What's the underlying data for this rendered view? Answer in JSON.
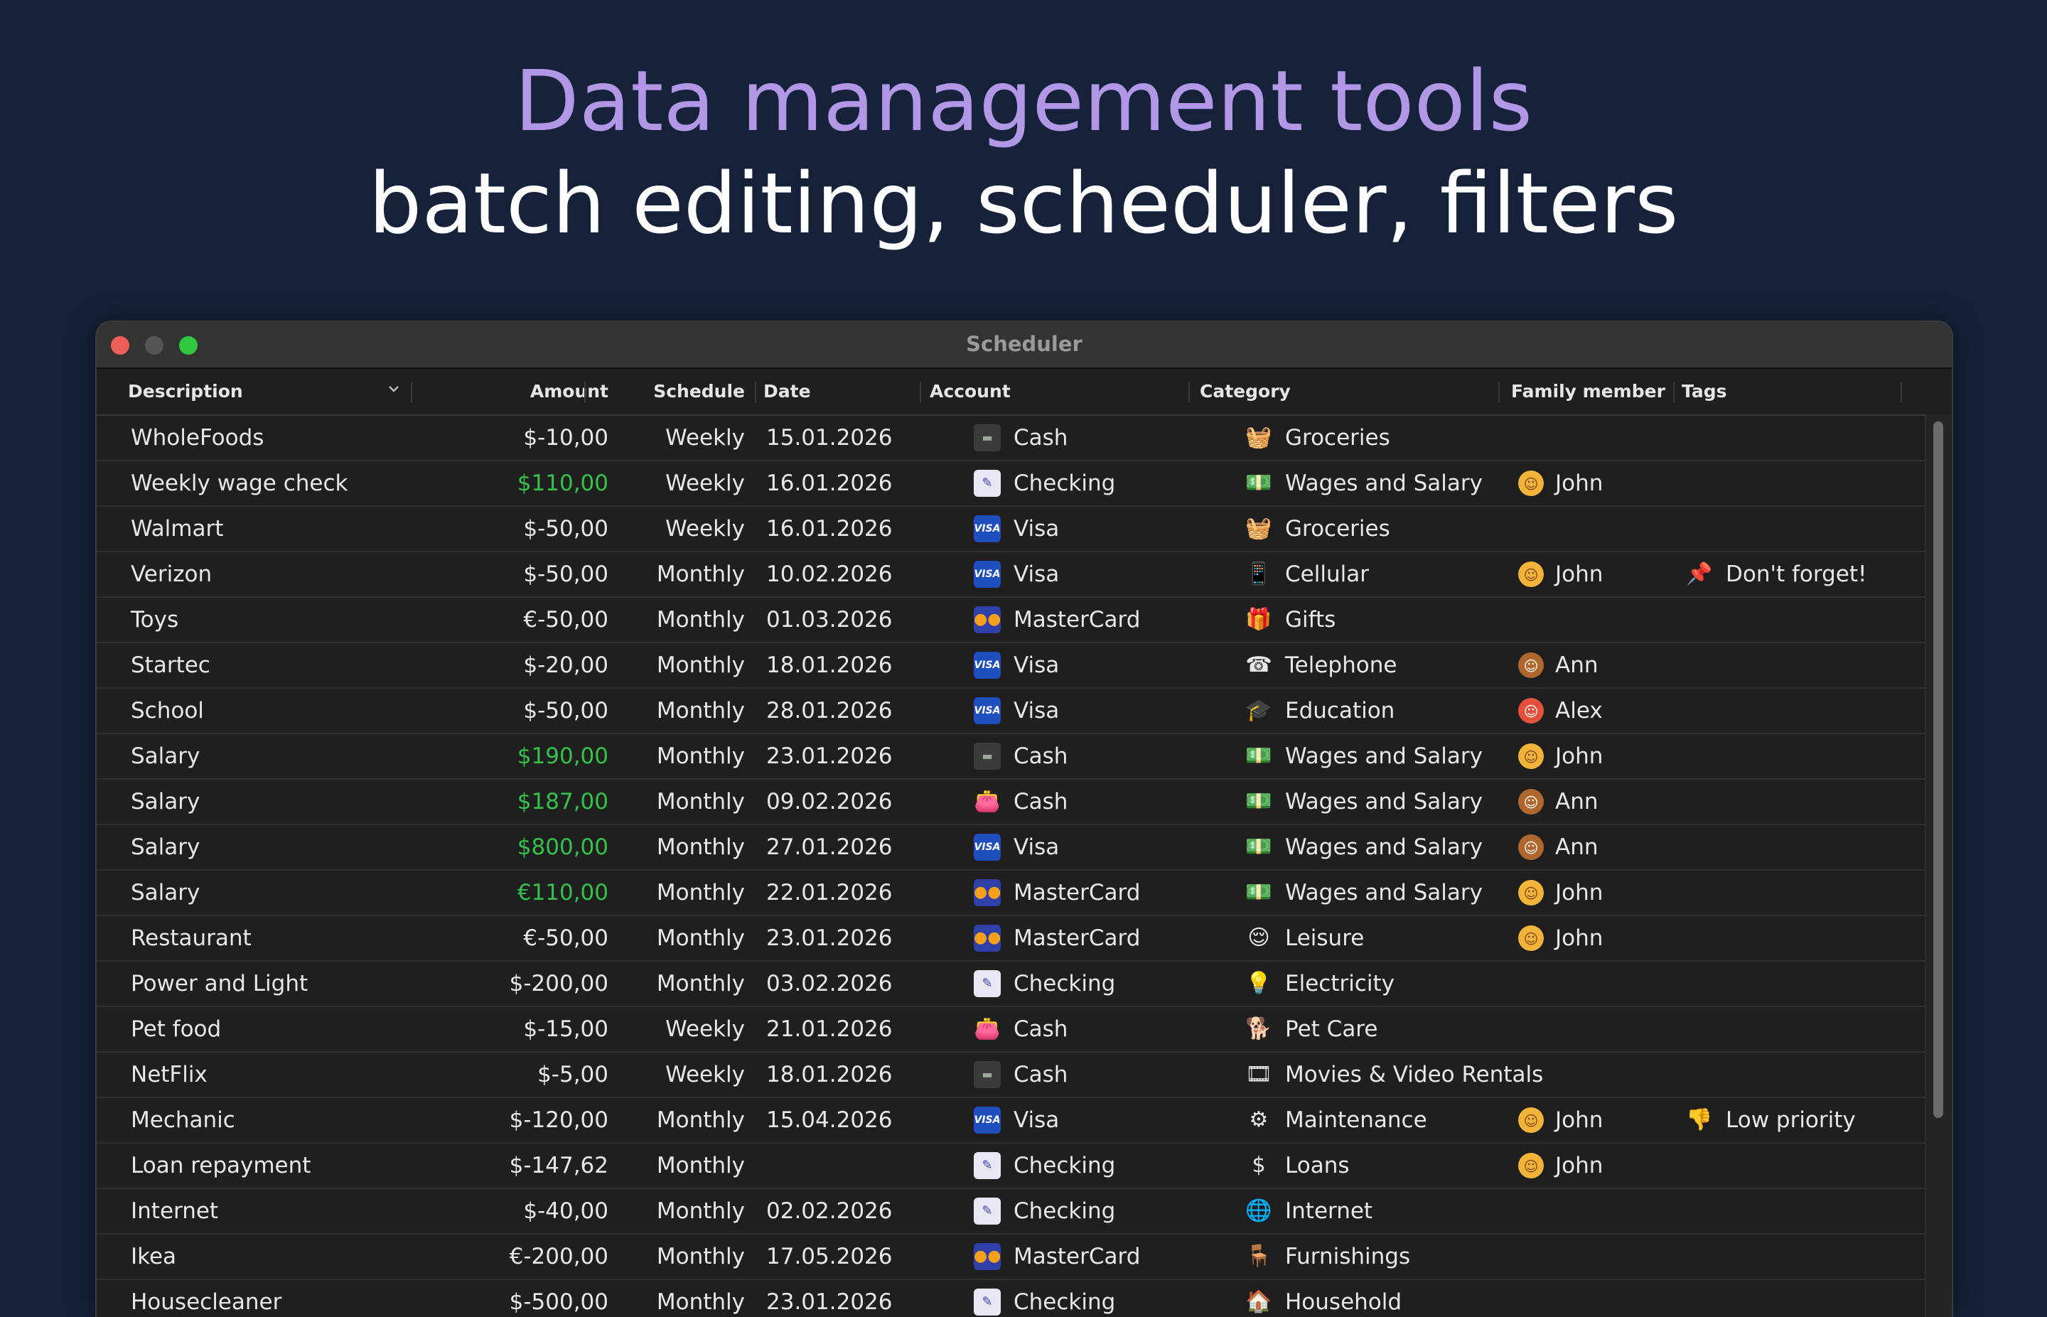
{
  "headline": {
    "line1": "Data management tools",
    "line2": "batch editing, scheduler, filters"
  },
  "window": {
    "title": "Scheduler"
  },
  "columns": {
    "description": "Description",
    "amount": "Amount",
    "schedule": "Schedule",
    "date": "Date",
    "account": "Account",
    "category": "Category",
    "family": "Family member",
    "tags": "Tags"
  },
  "rows": [
    {
      "desc": "WholeFoods",
      "amount": "$-10,00",
      "positive": false,
      "schedule": "Weekly",
      "date": "15.01.2026",
      "account": "Cash",
      "account_icon": "wallet-icon",
      "category": "Groceries",
      "category_icon": "grocery-basket-icon",
      "family": "",
      "tag": ""
    },
    {
      "desc": "Weekly wage check",
      "amount": "$110,00",
      "positive": true,
      "schedule": "Weekly",
      "date": "16.01.2026",
      "account": "Checking",
      "account_icon": "check-icon",
      "category": "Wages and Salary",
      "category_icon": "money-envelope-icon",
      "family": "John",
      "tag": ""
    },
    {
      "desc": "Walmart",
      "amount": "$-50,00",
      "positive": false,
      "schedule": "Weekly",
      "date": "16.01.2026",
      "account": "Visa",
      "account_icon": "visa-card-icon",
      "category": "Groceries",
      "category_icon": "grocery-basket-icon",
      "family": "",
      "tag": ""
    },
    {
      "desc": "Verizon",
      "amount": "$-50,00",
      "positive": false,
      "schedule": "Monthly",
      "date": "10.02.2026",
      "account": "Visa",
      "account_icon": "visa-card-icon",
      "category": "Cellular",
      "category_icon": "phone-icon",
      "family": "John",
      "tag": "Don't forget!"
    },
    {
      "desc": "Toys",
      "amount": "€-50,00",
      "positive": false,
      "schedule": "Monthly",
      "date": "01.03.2026",
      "account": "MasterCard",
      "account_icon": "mastercard-icon",
      "category": "Gifts",
      "category_icon": "gift-icon",
      "family": "",
      "tag": ""
    },
    {
      "desc": "Startec",
      "amount": "$-20,00",
      "positive": false,
      "schedule": "Monthly",
      "date": "18.01.2026",
      "account": "Visa",
      "account_icon": "visa-card-icon",
      "category": "Telephone",
      "category_icon": "telephone-icon",
      "family": "Ann",
      "tag": ""
    },
    {
      "desc": "School",
      "amount": "$-50,00",
      "positive": false,
      "schedule": "Monthly",
      "date": "28.01.2026",
      "account": "Visa",
      "account_icon": "visa-card-icon",
      "category": "Education",
      "category_icon": "graduation-cap-icon",
      "family": "Alex",
      "tag": ""
    },
    {
      "desc": "Salary",
      "amount": "$190,00",
      "positive": true,
      "schedule": "Monthly",
      "date": "23.01.2026",
      "account": "Cash",
      "account_icon": "wallet-icon",
      "category": "Wages and Salary",
      "category_icon": "money-envelope-icon",
      "family": "John",
      "tag": ""
    },
    {
      "desc": "Salary",
      "amount": "$187,00",
      "positive": true,
      "schedule": "Monthly",
      "date": "09.02.2026",
      "account": "Cash",
      "account_icon": "purse-icon",
      "category": "Wages and Salary",
      "category_icon": "money-envelope-icon",
      "family": "Ann",
      "tag": ""
    },
    {
      "desc": "Salary",
      "amount": "$800,00",
      "positive": true,
      "schedule": "Monthly",
      "date": "27.01.2026",
      "account": "Visa",
      "account_icon": "visa-card-icon",
      "category": "Wages and Salary",
      "category_icon": "money-envelope-icon",
      "family": "Ann",
      "tag": ""
    },
    {
      "desc": "Salary",
      "amount": "€110,00",
      "positive": true,
      "schedule": "Monthly",
      "date": "22.01.2026",
      "account": "MasterCard",
      "account_icon": "mastercard-icon",
      "category": "Wages and Salary",
      "category_icon": "money-envelope-icon",
      "family": "John",
      "tag": ""
    },
    {
      "desc": "Restaurant",
      "amount": "€-50,00",
      "positive": false,
      "schedule": "Monthly",
      "date": "23.01.2026",
      "account": "MasterCard",
      "account_icon": "mastercard-icon",
      "category": "Leisure",
      "category_icon": "smile-face-icon",
      "family": "John",
      "tag": ""
    },
    {
      "desc": "Power and Light",
      "amount": "$-200,00",
      "positive": false,
      "schedule": "Monthly",
      "date": "03.02.2026",
      "account": "Checking",
      "account_icon": "check-icon",
      "category": "Electricity",
      "category_icon": "light-bulb-icon",
      "family": "",
      "tag": ""
    },
    {
      "desc": "Pet food",
      "amount": "$-15,00",
      "positive": false,
      "schedule": "Weekly",
      "date": "21.01.2026",
      "account": "Cash",
      "account_icon": "purse-icon",
      "category": "Pet Care",
      "category_icon": "dog-icon",
      "family": "",
      "tag": ""
    },
    {
      "desc": "NetFlix",
      "amount": "$-5,00",
      "positive": false,
      "schedule": "Weekly",
      "date": "18.01.2026",
      "account": "Cash",
      "account_icon": "wallet-icon",
      "category": "Movies & Video Rentals",
      "category_icon": "film-reel-icon",
      "family": "",
      "tag": ""
    },
    {
      "desc": "Mechanic",
      "amount": "$-120,00",
      "positive": false,
      "schedule": "Monthly",
      "date": "15.04.2026",
      "account": "Visa",
      "account_icon": "visa-card-icon",
      "category": "Maintenance",
      "category_icon": "gear-icon",
      "family": "John",
      "tag": "Low priority"
    },
    {
      "desc": "Loan repayment",
      "amount": "$-147,62",
      "positive": false,
      "schedule": "Monthly",
      "date": "",
      "account": "Checking",
      "account_icon": "check-icon",
      "category": "Loans",
      "category_icon": "dollar-cycle-icon",
      "family": "John",
      "tag": ""
    },
    {
      "desc": "Internet",
      "amount": "$-40,00",
      "positive": false,
      "schedule": "Monthly",
      "date": "02.02.2026",
      "account": "Checking",
      "account_icon": "check-icon",
      "category": "Internet",
      "category_icon": "globe-icon",
      "family": "",
      "tag": ""
    },
    {
      "desc": "Ikea",
      "amount": "€-200,00",
      "positive": false,
      "schedule": "Monthly",
      "date": "17.05.2026",
      "account": "MasterCard",
      "account_icon": "mastercard-icon",
      "category": "Furnishings",
      "category_icon": "chair-icon",
      "family": "",
      "tag": ""
    },
    {
      "desc": "Housecleaner",
      "amount": "$-500,00",
      "positive": false,
      "schedule": "Monthly",
      "date": "23.01.2026",
      "account": "Checking",
      "account_icon": "check-icon",
      "category": "Household",
      "category_icon": "house-icon",
      "family": "",
      "tag": ""
    }
  ],
  "colors": {
    "background": "#16213a",
    "headline_accent": "#b197e6",
    "positive_amount": "#35c24a",
    "window_bg": "#1f1f1f"
  }
}
